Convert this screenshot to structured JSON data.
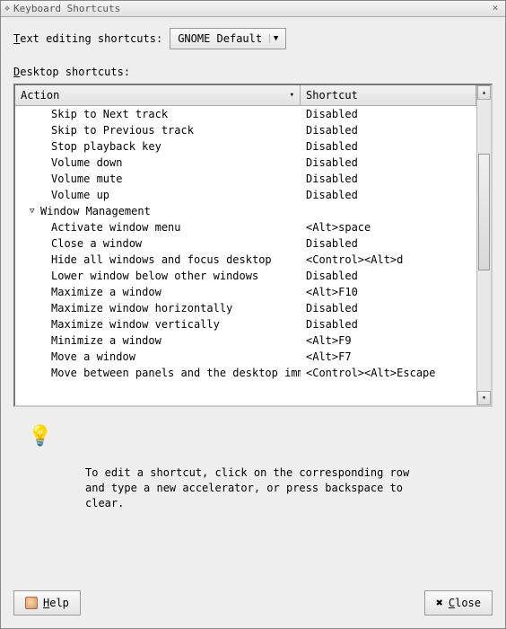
{
  "window": {
    "title": "Keyboard Shortcuts"
  },
  "text_editing_label": "ext editing shortcuts:",
  "combo": {
    "value": "GNOME Default"
  },
  "desktop_label": "esktop shortcuts:",
  "columns": {
    "action": "Action",
    "shortcut": "Shortcut"
  },
  "rows": [
    {
      "type": "item",
      "action": "Skip to Next track",
      "shortcut": "Disabled"
    },
    {
      "type": "item",
      "action": "Skip to Previous track",
      "shortcut": "Disabled"
    },
    {
      "type": "item",
      "action": "Stop playback key",
      "shortcut": "Disabled"
    },
    {
      "type": "item",
      "action": "Volume down",
      "shortcut": "Disabled"
    },
    {
      "type": "item",
      "action": "Volume mute",
      "shortcut": "Disabled"
    },
    {
      "type": "item",
      "action": "Volume up",
      "shortcut": "Disabled"
    },
    {
      "type": "group",
      "action": "Window Management",
      "shortcut": ""
    },
    {
      "type": "item",
      "action": "Activate window menu",
      "shortcut": "<Alt>space"
    },
    {
      "type": "item",
      "action": "Close a window",
      "shortcut": "Disabled"
    },
    {
      "type": "item",
      "action": "Hide all windows and focus desktop",
      "shortcut": "<Control><Alt>d"
    },
    {
      "type": "item",
      "action": "Lower window below other windows",
      "shortcut": "Disabled"
    },
    {
      "type": "item",
      "action": "Maximize a window",
      "shortcut": "<Alt>F10"
    },
    {
      "type": "item",
      "action": "Maximize window horizontally",
      "shortcut": "Disabled"
    },
    {
      "type": "item",
      "action": "Maximize window vertically",
      "shortcut": "Disabled"
    },
    {
      "type": "item",
      "action": "Minimize a window",
      "shortcut": "<Alt>F9"
    },
    {
      "type": "item",
      "action": "Move a window",
      "shortcut": "<Alt>F7"
    },
    {
      "type": "item",
      "action": "Move between panels and the desktop immediately",
      "shortcut": "<Control><Alt>Escape"
    }
  ],
  "hint": "To edit a shortcut, click on the corresponding row and type a new accelerator, or press backspace to clear.",
  "buttons": {
    "help": "elp",
    "close": "lose"
  }
}
